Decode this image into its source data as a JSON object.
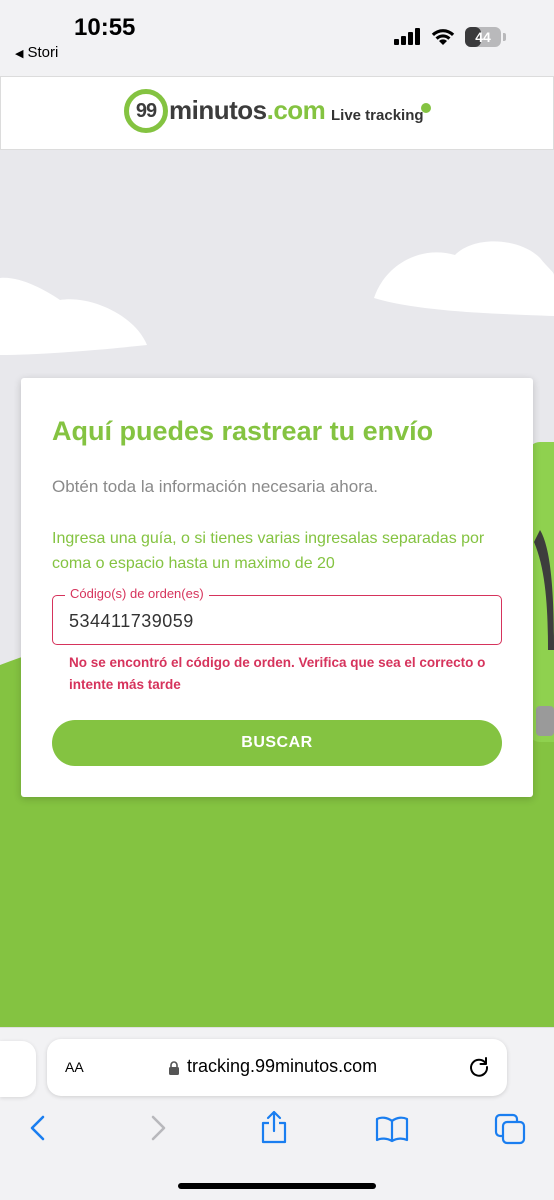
{
  "status_bar": {
    "time": "10:55",
    "back_app": "Stori",
    "battery_level": "44",
    "battery_fraction": 0.44
  },
  "header": {
    "logo_number": "99",
    "logo_name": "minutos",
    "logo_domain": ".com",
    "live_tracking": "Live tracking",
    "brand_color": "#84c341"
  },
  "card": {
    "title": "Aquí puedes rastrear tu envío",
    "subtitle": "Obtén toda la información necesaria ahora.",
    "instructions": "Ingresa una guía, o si tienes varias ingresalas separadas por coma o espacio hasta un maximo de 20",
    "field_label": "Código(s) de orden(es)",
    "field_value": "534411739059",
    "error_message": "No se encontró el código de orden. Verifica que sea el correcto o intente más tarde",
    "search_button": "BUSCAR",
    "error_color": "#d6335c"
  },
  "browser": {
    "aa_label": "AA",
    "url": "tracking.99minutos.com",
    "icons": [
      "back-arrow",
      "forward-arrow",
      "share",
      "bookmarks",
      "tabs",
      "reload",
      "lock"
    ]
  }
}
